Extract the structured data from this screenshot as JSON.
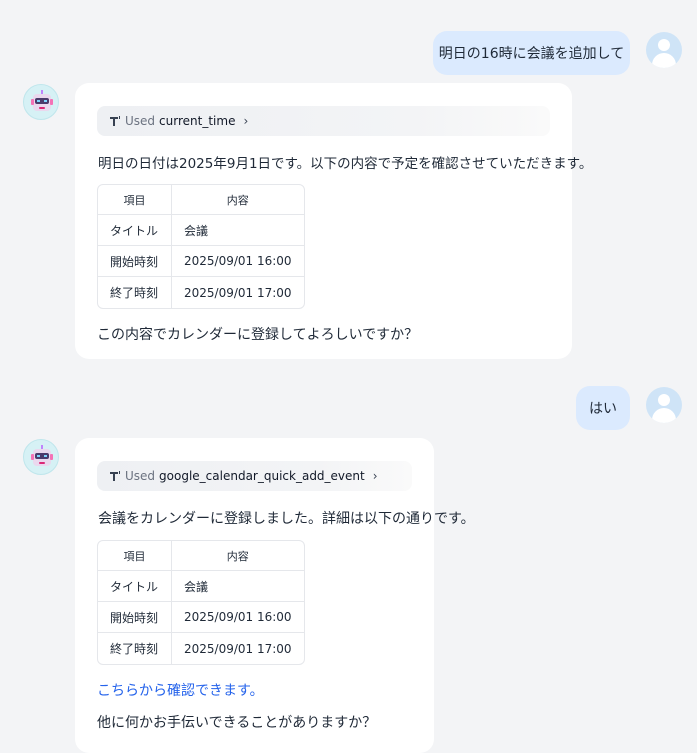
{
  "messages": [
    {
      "role": "user",
      "text": "明日の16時に会議を追加して"
    },
    {
      "role": "assistant",
      "tool": {
        "used_label": "Used",
        "name": "current_time",
        "icon": "tool-icon"
      },
      "intro": "明日の日付は2025年9月1日です。以下の内容で予定を確認させていただきます。",
      "table": {
        "headers": [
          "項目",
          "内容"
        ],
        "rows": [
          [
            "タイトル",
            "会議"
          ],
          [
            "開始時刻",
            "2025/09/01 16:00"
          ],
          [
            "終了時刻",
            "2025/09/01 17:00"
          ]
        ]
      },
      "outro": "この内容でカレンダーに登録してよろしいですか？"
    },
    {
      "role": "user",
      "text": "はい"
    },
    {
      "role": "assistant",
      "tool": {
        "used_label": "Used",
        "name": "google_calendar_quick_add_event",
        "icon": "tool-icon"
      },
      "intro": "会議をカレンダーに登録しました。詳細は以下の通りです。",
      "table": {
        "headers": [
          "項目",
          "内容"
        ],
        "rows": [
          [
            "タイトル",
            "会議"
          ],
          [
            "開始時刻",
            "2025/09/01 16:00"
          ],
          [
            "終了時刻",
            "2025/09/01 17:00"
          ]
        ]
      },
      "link": "こちらから確認できます。",
      "outro": "他に何かお手伝いできることがありますか？"
    }
  ],
  "colors": {
    "background": "#f3f4f6",
    "user_bubble": "#dbeafe",
    "link": "#2563eb",
    "bot_avatar_bg": "#d6f1f5",
    "user_avatar_bg": "#cfe4f7"
  },
  "icons": {
    "user_avatar": "user-avatar-icon",
    "assistant_avatar": "robot-avatar-icon",
    "expand": "chevron-right-icon"
  }
}
